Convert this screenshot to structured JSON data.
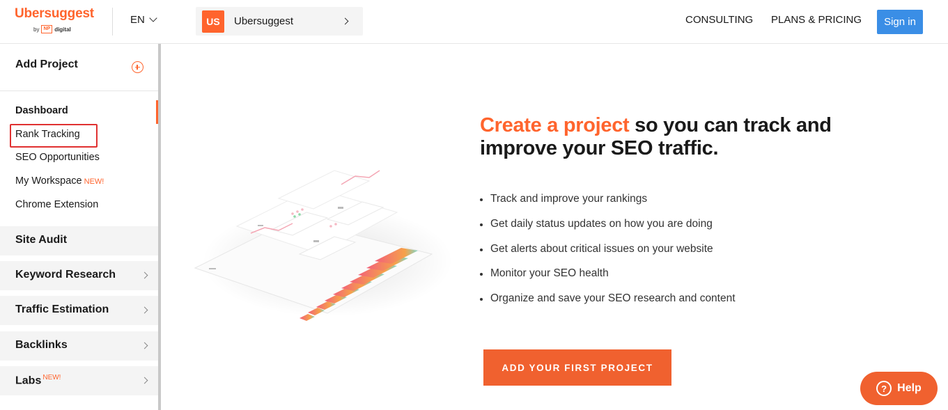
{
  "header": {
    "logo_name": "Ubersuggest",
    "logo_by": "by",
    "logo_np": "NP",
    "logo_digital": "digital",
    "language": "EN",
    "project_badge": "US",
    "project_name": "Ubersuggest",
    "nav": {
      "consulting": "CONSULTING",
      "plans": "PLANS & PRICING"
    },
    "signin": "Sign in"
  },
  "sidebar": {
    "add_project": "Add Project",
    "items": [
      {
        "label": "Dashboard"
      },
      {
        "label": "Rank Tracking"
      },
      {
        "label": "SEO Opportunities"
      },
      {
        "label": "My Workspace",
        "badge": "NEW!"
      },
      {
        "label": "Chrome Extension"
      }
    ],
    "sections": [
      {
        "label": "Site Audit"
      },
      {
        "label": "Keyword Research"
      },
      {
        "label": "Traffic Estimation"
      },
      {
        "label": "Backlinks"
      },
      {
        "label": "Labs",
        "badge": "NEW!"
      }
    ]
  },
  "main": {
    "headline_accent": "Create a project",
    "headline_rest": " so you can track and improve your SEO traffic.",
    "bullets": [
      "Track and improve your rankings",
      "Get daily status updates on how you are doing",
      "Get alerts about critical issues on your website",
      "Monitor your SEO health",
      "Organize and save your SEO research and content"
    ],
    "cta": "ADD YOUR FIRST PROJECT"
  },
  "help": {
    "label": "Help",
    "icon": "question-icon"
  },
  "colors": {
    "accent": "#ff642d",
    "signin": "#3a8ee6",
    "highlight": "#e03131"
  }
}
